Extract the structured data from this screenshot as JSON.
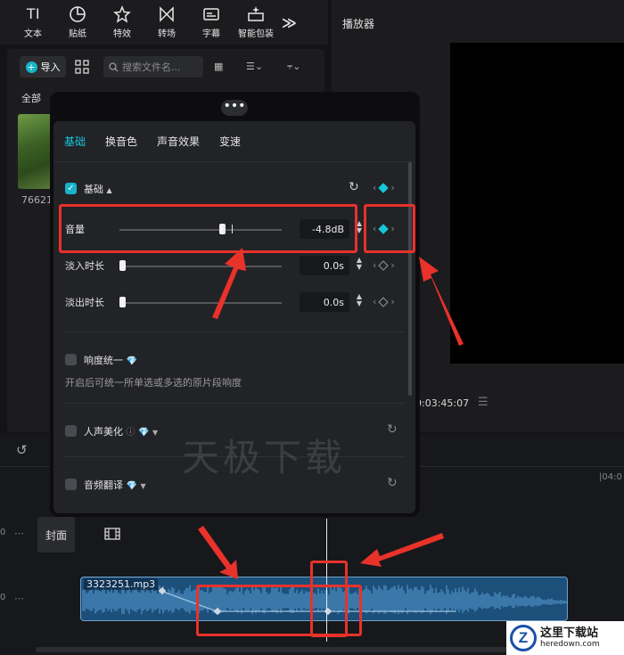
{
  "toolbar": {
    "items": [
      {
        "label": "文本",
        "glyph": "TI",
        "icon": "text-icon"
      },
      {
        "label": "贴纸",
        "icon": "sticker-icon"
      },
      {
        "label": "特效",
        "icon": "effects-star-icon"
      },
      {
        "label": "转场",
        "icon": "transition-bowtie-icon"
      },
      {
        "label": "字幕",
        "icon": "subtitle-icon"
      },
      {
        "label": "智能包装",
        "icon": "smart-pack-icon"
      }
    ],
    "more": "≫"
  },
  "media": {
    "import_label": "导入",
    "search_placeholder": "搜索文件名...",
    "tab_all": "全部",
    "thumb_label": "76621"
  },
  "player": {
    "title": "播放器",
    "timecode": "0:03:45:07"
  },
  "panel": {
    "tabs": [
      "基础",
      "换音色",
      "声音效果",
      "变速"
    ],
    "section_title": "基础",
    "volume": {
      "label": "音量",
      "value": "-4.8dB",
      "level": 0.63
    },
    "fade_in": {
      "label": "淡入时长",
      "value": "0.0s",
      "level": 0
    },
    "fade_out": {
      "label": "淡出时长",
      "value": "0.0s",
      "level": 0
    },
    "loudness": {
      "label": "响度统一",
      "desc": "开启后可统一所单选或多选的原片段响度"
    },
    "voice_beauty": {
      "label": "人声美化"
    },
    "audio_translate": {
      "label": "音频翻译"
    }
  },
  "timeline": {
    "cover_label": "封面",
    "clip_name": "3323251.mp3",
    "ruler_tick": "|04:0",
    "track_zero": "0",
    "track_more": "⋯"
  },
  "watermark": {
    "center_text": "天极下载",
    "corner_cn": "这里下载站",
    "corner_en": "heredown.com",
    "corner_letter": "Z"
  },
  "colors": {
    "accent": "#16c7d8",
    "annotation": "#e8322a",
    "clip": "#1c4f7a"
  }
}
